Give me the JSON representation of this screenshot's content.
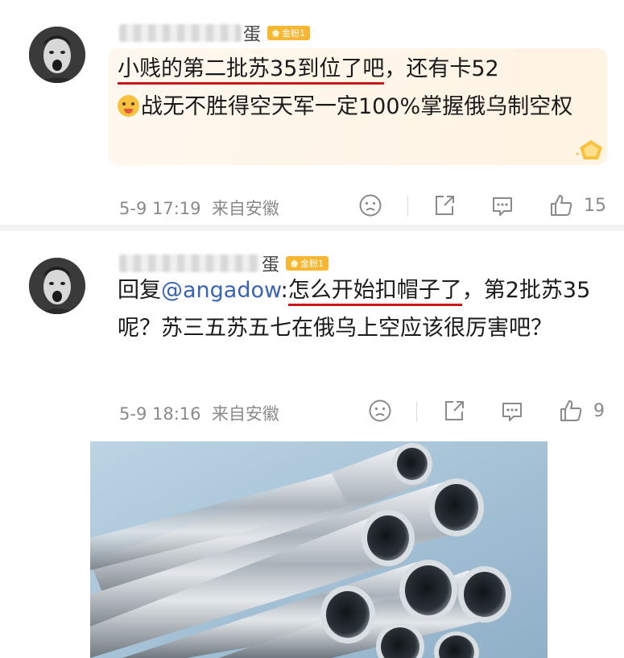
{
  "comments": [
    {
      "username_visible": "蛋",
      "badge": "金粉1",
      "text_underlined": "小贱的第二批苏35到位了吧",
      "text_rest_1": "，还有卡52",
      "text_rest_2": "战无不胜得空天军一定100%掌握俄乌制空权",
      "time": "5-9 17:19",
      "location": "来自安徽",
      "likes": "15"
    },
    {
      "username_visible": "蛋",
      "badge": "金粉1",
      "reply_prefix": "回复",
      "mention": "@angadow",
      "colon": ":",
      "text_underlined": "怎么开始扣帽子了",
      "text_rest": "，第2批苏35呢？苏三五苏五七在俄乌上空应该很厉害吧？",
      "time": "5-9 18:16",
      "location": "来自安徽",
      "likes": "9"
    }
  ],
  "icons": [
    "dislike-icon",
    "share-icon",
    "comment-icon",
    "like-icon"
  ],
  "colors": {
    "underline": "#c91818",
    "mention": "#3a63b5",
    "badge": "#f7b733",
    "meta": "#8a8a8a"
  }
}
